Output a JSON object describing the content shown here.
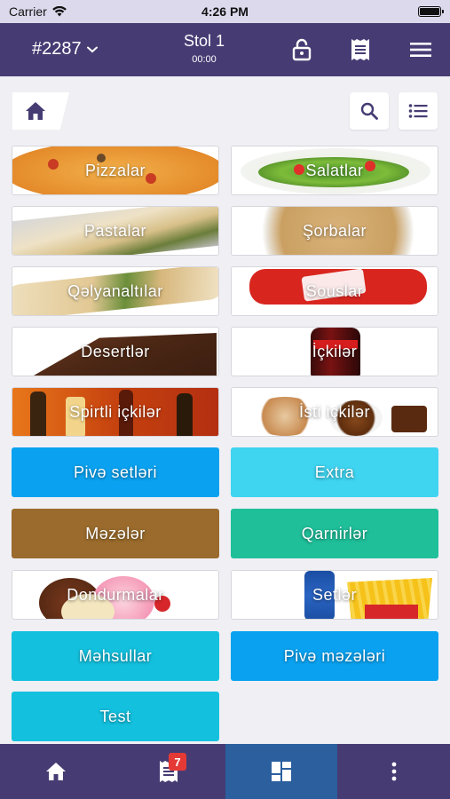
{
  "status_bar": {
    "carrier": "Carrier",
    "time": "4:26 PM"
  },
  "header": {
    "order_number": "#2287",
    "table_name": "Stol 1",
    "timer": "00:00"
  },
  "categories": [
    {
      "label": "Pizzalar"
    },
    {
      "label": "Salatlar"
    },
    {
      "label": "Pastalar"
    },
    {
      "label": "Şorbalar"
    },
    {
      "label": "Qəlyanaltılar"
    },
    {
      "label": "Souslar"
    },
    {
      "label": "Desertlər"
    },
    {
      "label": "İçkilər"
    },
    {
      "label": "Spirtli içkilər"
    },
    {
      "label": "İsti içkilər"
    },
    {
      "label": "Pivə setləri",
      "color": "#0aa2f0"
    },
    {
      "label": "Extra",
      "color": "#3fd4f0"
    },
    {
      "label": "Məzələr",
      "color": "#9a6b2c"
    },
    {
      "label": "Qarnirlər",
      "color": "#1fbf9a"
    },
    {
      "label": "Dondurmalar"
    },
    {
      "label": "Setlər"
    },
    {
      "label": "Məhsullar",
      "color": "#13c0de"
    },
    {
      "label": "Pivə məzələri",
      "color": "#0aa2f0"
    },
    {
      "label": "Test",
      "color": "#13c0de"
    }
  ],
  "tab_bar": {
    "orders_badge": "7"
  },
  "colors": {
    "nav": "#463c73",
    "active_tab": "#2b5f9e",
    "icon_accent": "#463c73"
  }
}
